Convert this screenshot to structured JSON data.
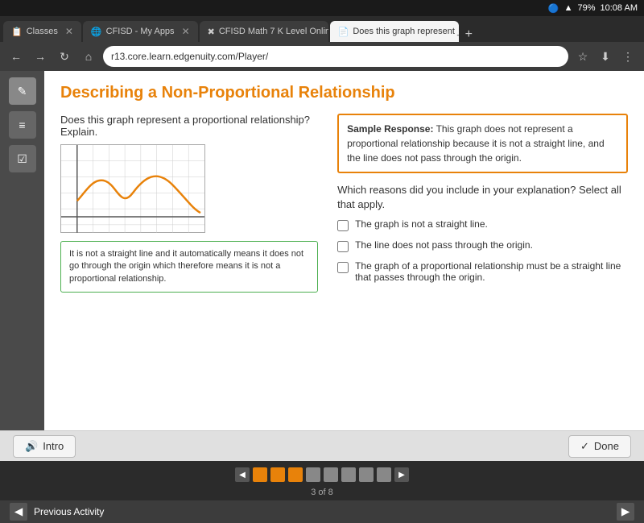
{
  "status_bar": {
    "bluetooth": "🔵",
    "wifi": "📶",
    "battery": "79%",
    "time": "10:08 AM"
  },
  "tabs": [
    {
      "id": "classes",
      "label": "Classes",
      "active": false,
      "favicon": "📋"
    },
    {
      "id": "myapps",
      "label": "CFISD - My Apps",
      "active": false,
      "favicon": "🌐"
    },
    {
      "id": "math",
      "label": "CFISD Math 7 K Level Onlin...",
      "active": false,
      "favicon": "✖"
    },
    {
      "id": "docs",
      "label": "Does this graph represent _",
      "active": true,
      "favicon": "📄"
    }
  ],
  "address_bar": {
    "url": "r13.core.learn.edgenuity.com/Player/"
  },
  "page": {
    "title": "Describing a Non-Proportional Relationship",
    "question_text": "Does this graph represent a proportional relationship? Explain.",
    "user_response": "It is not a straight line and it automatically means it does not go through the origin which therefore means it is not a proportional relationship.",
    "sample_response": {
      "label": "Sample Response:",
      "text": " This graph does not represent a proportional relationship because it is not a straight line, and the line does not pass through the origin."
    },
    "reasons_prompt": "Which reasons did you include in your explanation? Select all that apply.",
    "checkboxes": [
      {
        "id": "cb1",
        "label": "The graph is not a straight line.",
        "checked": false
      },
      {
        "id": "cb2",
        "label": "The line does not pass through the origin.",
        "checked": false
      },
      {
        "id": "cb3",
        "label": "The graph of a proportional relationship must be a straight line that passes through the origin.",
        "checked": false
      }
    ]
  },
  "bottom_nav": {
    "intro_label": "Intro",
    "done_label": "Done"
  },
  "pagination": {
    "current": "3",
    "total": "8",
    "label": "3 of 8"
  },
  "prev_activity": {
    "label": "Previous Activity"
  },
  "icons": {
    "home": "⌂",
    "back": "←",
    "forward": "→",
    "refresh": "↻",
    "star": "☆",
    "download": "⬇",
    "menu": "⋮",
    "speaker": "🔊",
    "check": "✓",
    "pencil": "✎",
    "calculator": "🧮",
    "clipboard": "📋"
  }
}
